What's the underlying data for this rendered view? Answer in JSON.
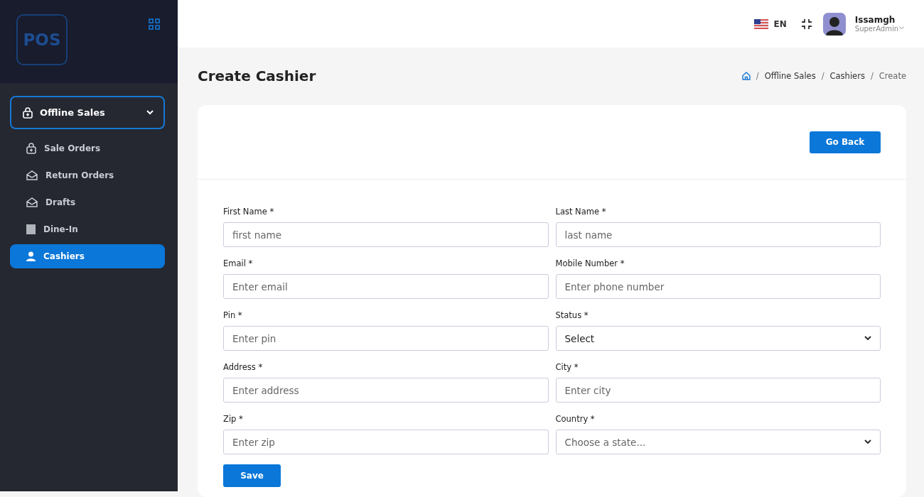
{
  "sidebar": {
    "logo": "POS",
    "group": {
      "label": "Offline Sales",
      "expanded": true
    },
    "items": [
      {
        "label": "Sale Orders",
        "selected": false
      },
      {
        "label": "Return Orders",
        "selected": false
      },
      {
        "label": "Drafts",
        "selected": false
      },
      {
        "label": "Dine-In",
        "selected": false
      },
      {
        "label": "Cashiers",
        "selected": true
      }
    ]
  },
  "topbar": {
    "language": "EN",
    "user": {
      "name": "Issamgh",
      "role": "SuperAdmin"
    }
  },
  "page": {
    "title": "Create Cashier",
    "breadcrumb_separator": "/",
    "breadcrumb": [
      "Offline Sales",
      "Cashiers",
      "Create"
    ]
  },
  "form": {
    "back_button": "Go Back",
    "save_button": "Save",
    "fields": [
      {
        "kind": "input",
        "label": "First Name *",
        "placeholder": "first name"
      },
      {
        "kind": "input",
        "label": "Last Name *",
        "placeholder": "last name"
      },
      {
        "kind": "input",
        "label": "Email *",
        "placeholder": "Enter email"
      },
      {
        "kind": "input",
        "label": "Mobile Number *",
        "placeholder": "Enter phone number"
      },
      {
        "kind": "input",
        "label": "Pin *",
        "placeholder": "Enter pin"
      },
      {
        "kind": "select",
        "label": "Status *",
        "value": "Select"
      },
      {
        "kind": "input",
        "label": "Address *",
        "placeholder": "Enter address"
      },
      {
        "kind": "input",
        "label": "City *",
        "placeholder": "Enter city"
      },
      {
        "kind": "input",
        "label": "Zip *",
        "placeholder": "Enter zip"
      },
      {
        "kind": "select",
        "label": "Country *",
        "placeholder": "Choose a state..."
      }
    ]
  }
}
